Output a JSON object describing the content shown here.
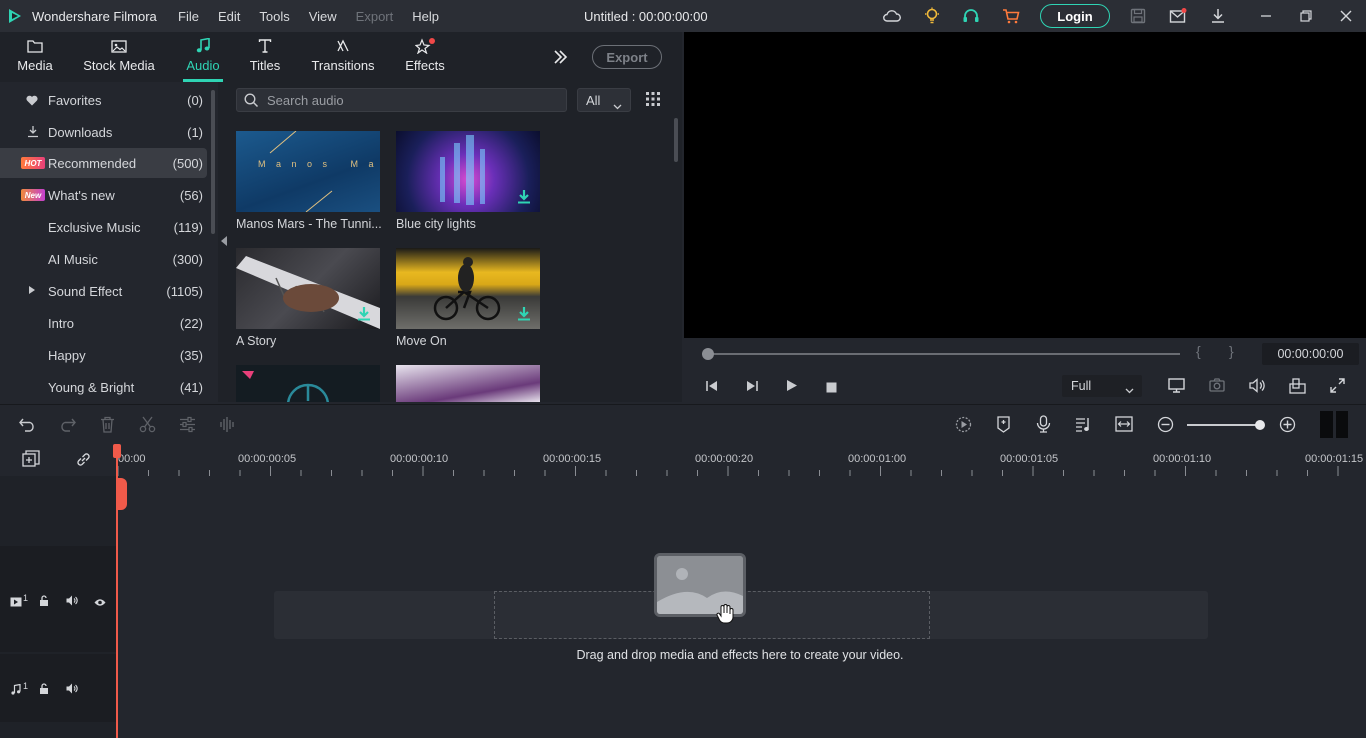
{
  "app": {
    "name": "Wondershare Filmora",
    "doc_title": "Untitled : 00:00:00:00"
  },
  "menu": [
    "File",
    "Edit",
    "Tools",
    "View",
    "Export",
    "Help"
  ],
  "titlebar": {
    "login": "Login"
  },
  "tabs": [
    {
      "label": "Media",
      "icon": "folder-icon"
    },
    {
      "label": "Stock Media",
      "icon": "image-icon"
    },
    {
      "label": "Audio",
      "icon": "music-note-icon",
      "active": true
    },
    {
      "label": "Titles",
      "icon": "text-icon"
    },
    {
      "label": "Transitions",
      "icon": "transition-icon"
    },
    {
      "label": "Effects",
      "icon": "effects-icon"
    }
  ],
  "export_label": "Export",
  "categories": [
    {
      "name": "Favorites",
      "count": "(0)",
      "icon": "heart-icon"
    },
    {
      "name": "Downloads",
      "count": "(1)",
      "icon": "download-icon"
    },
    {
      "name": "Recommended",
      "count": "(500)",
      "badge": "HOT",
      "active": true
    },
    {
      "name": "What's new",
      "count": "(56)",
      "badge": "New"
    },
    {
      "name": "Exclusive Music",
      "count": "(119)"
    },
    {
      "name": "AI Music",
      "count": "(300)"
    },
    {
      "name": "Sound Effect",
      "count": "(1105)",
      "expandable": true
    },
    {
      "name": "Intro",
      "count": "(22)"
    },
    {
      "name": "Happy",
      "count": "(35)"
    },
    {
      "name": "Young & Bright",
      "count": "(41)"
    }
  ],
  "search": {
    "placeholder": "Search audio",
    "filter": "All"
  },
  "audio_items": [
    {
      "title": "Manos Mars - The Tunni...",
      "thumb_text": "M a n o s   M a r s"
    },
    {
      "title": "Blue city lights"
    },
    {
      "title": "A Story"
    },
    {
      "title": "Move On"
    },
    {
      "title": ""
    },
    {
      "title": ""
    }
  ],
  "player": {
    "timecode": "00:00:00:00",
    "quality": "Full",
    "mark_in": "{",
    "mark_out": "}"
  },
  "ruler": [
    "00:00",
    "00:00:00:05",
    "00:00:00:10",
    "00:00:00:15",
    "00:00:00:20",
    "00:00:01:00",
    "00:00:01:05",
    "00:00:01:10",
    "00:00:01:15"
  ],
  "tracks": [
    {
      "label": "1",
      "type": "video"
    },
    {
      "label": "1",
      "type": "audio"
    }
  ],
  "drop_text": "Drag and drop media and effects here to create your video.",
  "colors": {
    "accent": "#2fd4b4",
    "playhead": "#f05a4a",
    "hot": "#e8407a",
    "new": "#c43fd0"
  }
}
